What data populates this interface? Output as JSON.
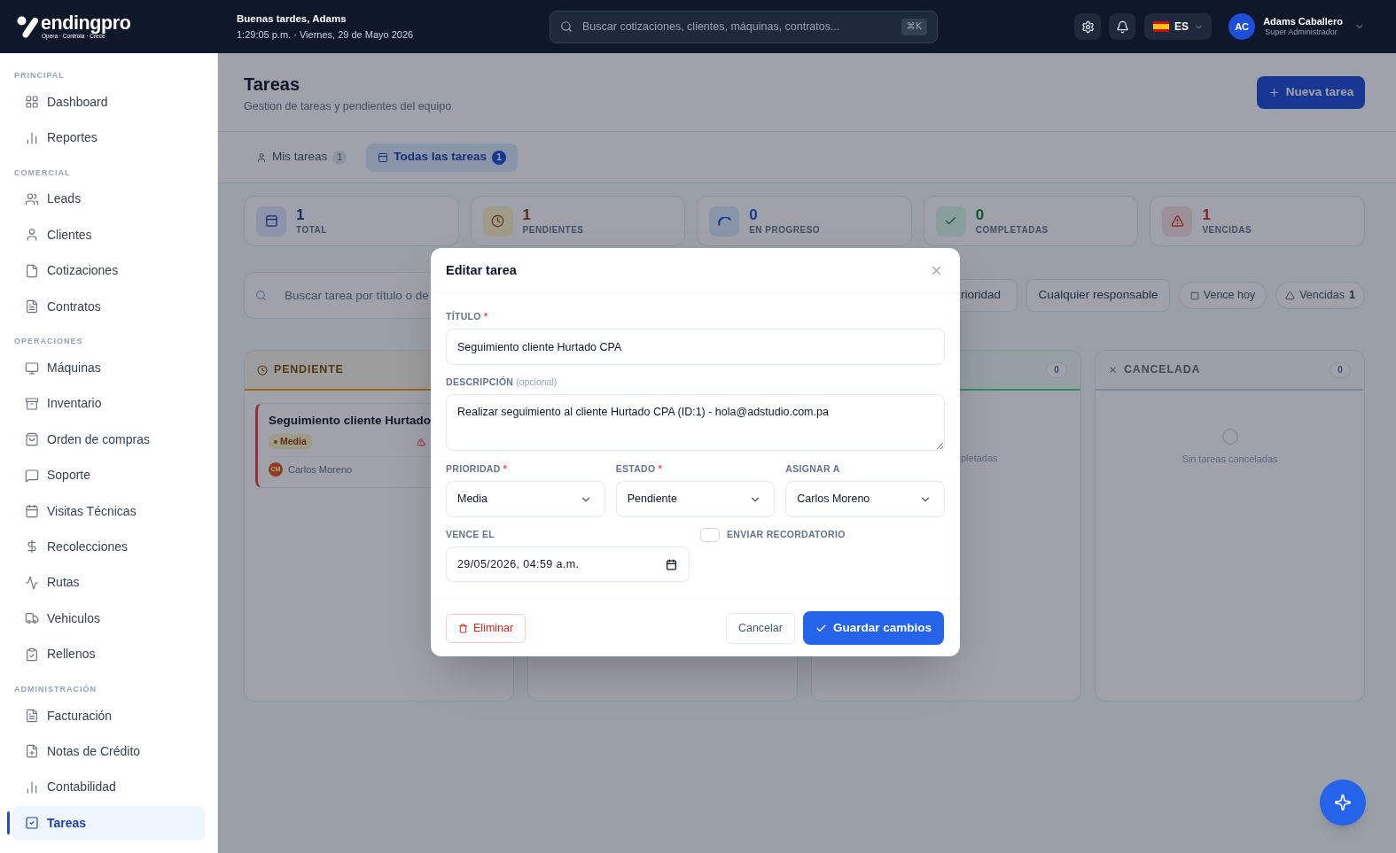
{
  "top_bar": {
    "logo": {
      "wordmark": "endingpro",
      "tagline": "Opera · Controla · Crece"
    },
    "greeting": "Buenas tardes, Adams",
    "datetime": "1:29:05 p.m. · Viernes, 29 de Mayo 2026",
    "search": {
      "placeholder": "Buscar cotizaciones, clientes, máquinas, contratos...",
      "shortcut": "⌘K"
    },
    "language": "ES",
    "user": {
      "initials": "AC",
      "name": "Adams Caballero",
      "role": "Super Administrador"
    }
  },
  "sidebar": {
    "sections": [
      {
        "title": "PRINCIPAL",
        "items": [
          {
            "label": "Dashboard",
            "selected": false
          },
          {
            "label": "Reportes",
            "selected": false
          }
        ]
      },
      {
        "title": "COMERCIAL",
        "items": [
          {
            "label": "Leads",
            "selected": false
          },
          {
            "label": "Clientes",
            "selected": false
          },
          {
            "label": "Cotizaciones",
            "selected": false
          },
          {
            "label": "Contratos",
            "selected": false
          }
        ]
      },
      {
        "title": "OPERACIONES",
        "items": [
          {
            "label": "Máquinas",
            "selected": false
          },
          {
            "label": "Inventario",
            "selected": false
          },
          {
            "label": "Orden de compras",
            "selected": false
          },
          {
            "label": "Soporte",
            "selected": false
          },
          {
            "label": "Visitas Técnicas",
            "selected": false
          },
          {
            "label": "Recolecciones",
            "selected": false
          },
          {
            "label": "Rutas",
            "selected": false
          },
          {
            "label": "Vehiculos",
            "selected": false
          },
          {
            "label": "Rellenos",
            "selected": false
          }
        ]
      },
      {
        "title": "ADMINISTRACIÓN",
        "items": [
          {
            "label": "Facturación",
            "selected": false
          },
          {
            "label": "Notas de Crédito",
            "selected": false
          },
          {
            "label": "Contabilidad",
            "selected": false
          },
          {
            "label": "Tareas",
            "selected": true
          }
        ]
      }
    ]
  },
  "page_header": {
    "title": "Tareas",
    "subtitle": "Gestion de tareas y pendientes del equipo",
    "new_task_button": "Nueva tarea"
  },
  "tabs": [
    {
      "label": "Mis tareas",
      "count": "1",
      "selected": false
    },
    {
      "label": "Todas las tareas",
      "count": "1",
      "selected": true
    }
  ],
  "stats": [
    {
      "value": "1",
      "label": "TOTAL",
      "color": "#8c94aa"
    },
    {
      "value": "1",
      "label": "PENDIENTES",
      "color": "#9e9b88"
    },
    {
      "value": "0",
      "label": "EN PROGRESO",
      "color": "#8996a9"
    },
    {
      "value": "0",
      "label": "COMPLETADAS",
      "color": "#8aa09b"
    },
    {
      "value": "1",
      "label": "VENCIDAS",
      "color": "#9e9198"
    }
  ],
  "filters": {
    "search": {
      "placeholder": "Buscar tarea por título o de"
    },
    "buttons": [
      {
        "kind": "select",
        "label": "rioridad"
      },
      {
        "kind": "select",
        "label": "Cualquier responsable"
      },
      {
        "kind": "chip",
        "label": "Vence hoy"
      },
      {
        "kind": "chip",
        "label": "Vencidas",
        "count": "1"
      }
    ]
  },
  "columns": [
    {
      "title": "PENDIENTE",
      "color": "#996817",
      "cards": [
        {
          "title": "Seguimiento cliente Hurtado",
          "priority": "Media",
          "overdue": true,
          "assignee": {
            "initials": "CM",
            "name": "Carlos Moreno"
          }
        }
      ]
    },
    {},
    {
      "count": "0",
      "color": "#328e5e",
      "empty_text_fragment": "pletadas"
    },
    {
      "title": "CANCELADA",
      "count": "0",
      "color": "#808998",
      "empty_text": "Sin tareas canceladas"
    }
  ],
  "modal": {
    "title": "Editar tarea",
    "rows": [
      {
        "fields": [
          {
            "kind": "text",
            "label": "TÍTULO",
            "required_mark": "*",
            "value": "Seguimiento cliente Hurtado CPA"
          }
        ]
      },
      {
        "fields": [
          {
            "kind": "textarea",
            "label": "DESCRIPCIÓN",
            "hint": "(opcional)",
            "value": "Realizar seguimiento al cliente Hurtado CPA (ID:1) - hola@adstudio.com.pa"
          }
        ]
      },
      {
        "fields": [
          {
            "kind": "select",
            "label": "PRIORIDAD",
            "required_mark": "*",
            "value": "Media"
          },
          {
            "kind": "select",
            "label": "ESTADO",
            "required_mark": "*",
            "value": "Pendiente"
          },
          {
            "kind": "select",
            "label": "ASIGNAR A",
            "value": "Carlos Moreno"
          }
        ]
      },
      {
        "fields": [
          {
            "kind": "datetime",
            "label": "VENCE EL",
            "value": "29/05/2026, 04:59 a.m."
          },
          {
            "kind": "checkbox",
            "label": "ENVIAR RECORDATORIO",
            "checked": false
          }
        ]
      }
    ],
    "buttons": [
      {
        "kind": "danger",
        "label": "Eliminar"
      },
      {
        "kind": "secondary",
        "label": "Cancelar"
      },
      {
        "kind": "primary",
        "label": "Guardar cambios"
      }
    ]
  }
}
